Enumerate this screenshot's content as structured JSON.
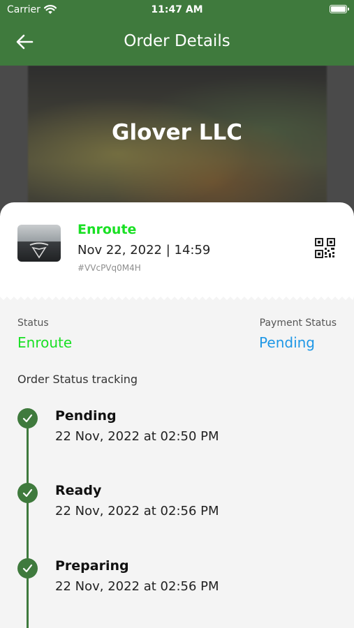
{
  "status_bar": {
    "carrier": "Carrier",
    "time": "11:47 AM"
  },
  "nav": {
    "title": "Order Details"
  },
  "banner": {
    "store_name": "Glover LLC"
  },
  "order": {
    "status": "Enroute",
    "date_time": "Nov 22, 2022 | 14:59",
    "id": "#VVcPVq0M4H"
  },
  "summary": {
    "status_label": "Status",
    "status_value": "Enroute",
    "payment_label": "Payment Status",
    "payment_value": "Pending"
  },
  "tracking": {
    "title": "Order Status tracking",
    "steps": [
      {
        "title": "Pending",
        "time": "22 Nov, 2022 at 02:50 PM"
      },
      {
        "title": "Ready",
        "time": "22 Nov, 2022 at 02:56 PM"
      },
      {
        "title": "Preparing",
        "time": "22 Nov, 2022 at 02:56 PM"
      }
    ]
  },
  "colors": {
    "header": "#3f7a3d",
    "status_green": "#19e024",
    "payment_blue": "#1e97e6"
  },
  "icons": [
    "wifi-icon",
    "battery-icon",
    "back-arrow-icon",
    "tesla-logo-icon",
    "qr-code-icon",
    "check-icon"
  ]
}
